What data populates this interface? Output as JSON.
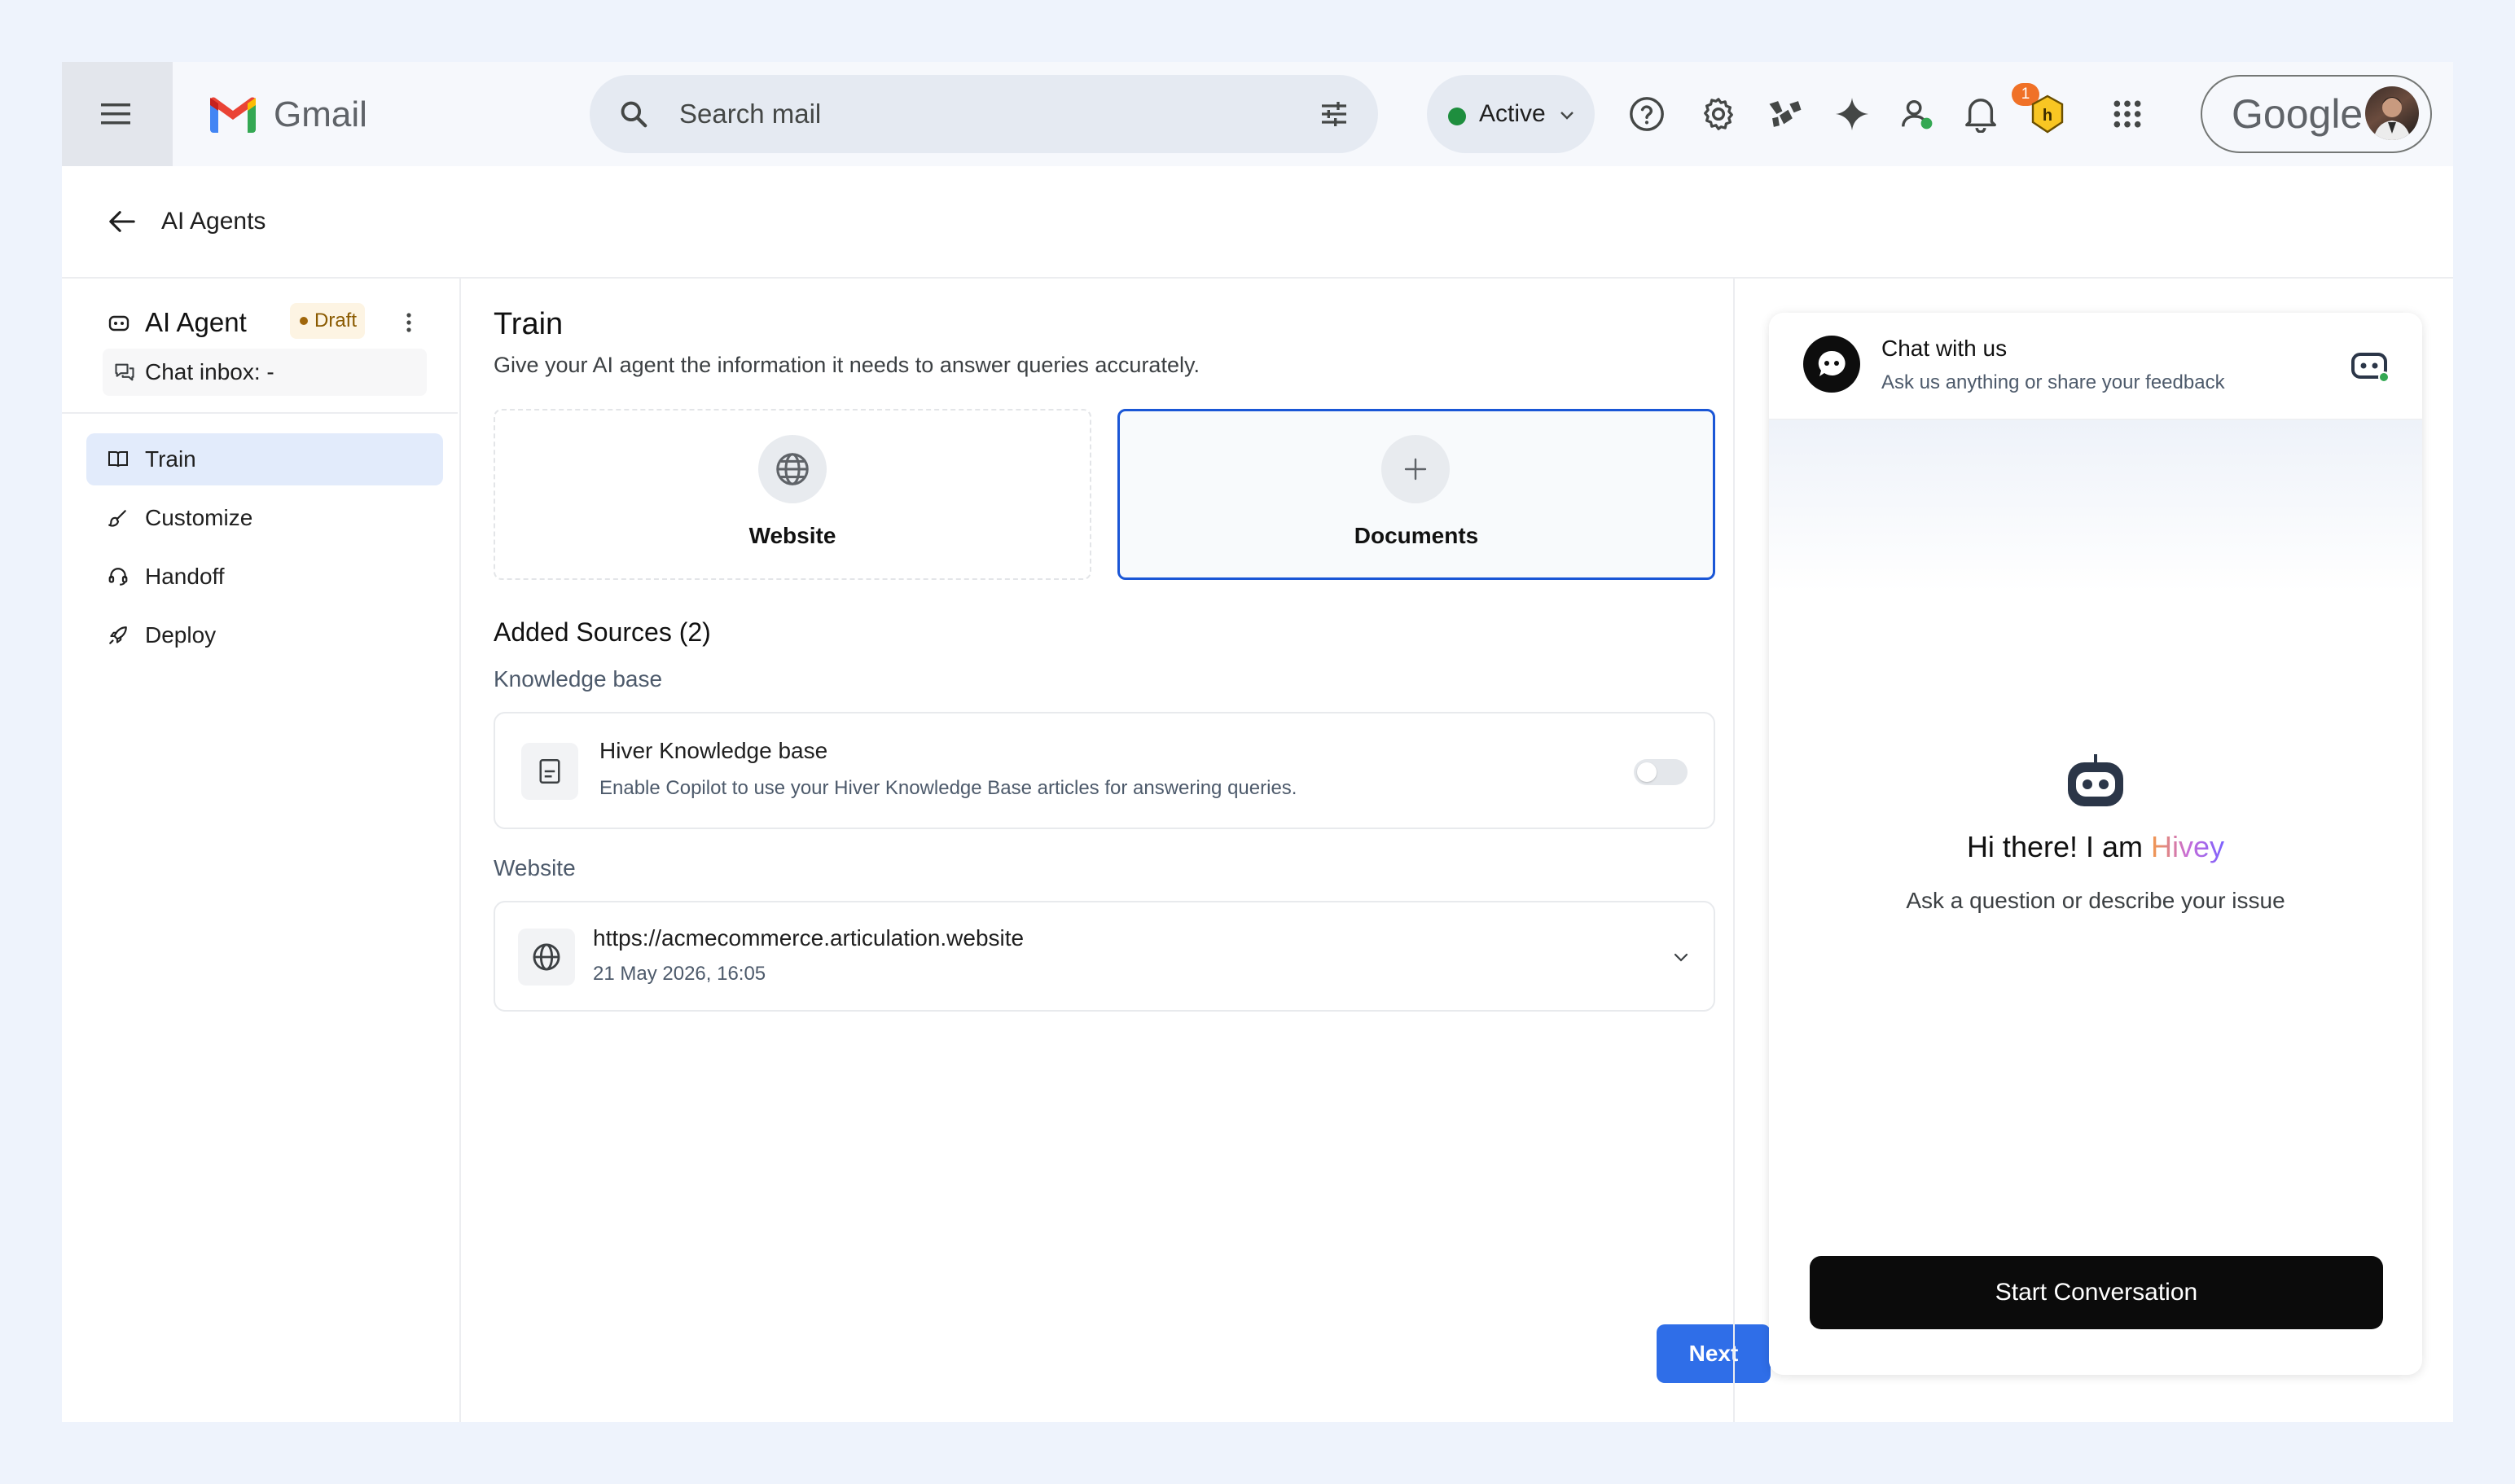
{
  "gmail": {
    "app_name": "Gmail",
    "search_placeholder": "Search mail",
    "status": "Active",
    "notification_count": "1",
    "account_brand": "Google"
  },
  "header": {
    "title": "AI Agents"
  },
  "sidebar": {
    "agent_name": "AI Agent",
    "agent_status": "Draft",
    "chat_inbox_label": "Chat inbox: -",
    "items": [
      {
        "label": "Train",
        "icon": "book-icon",
        "active": true
      },
      {
        "label": "Customize",
        "icon": "brush-icon",
        "active": false
      },
      {
        "label": "Handoff",
        "icon": "headset-icon",
        "active": false
      },
      {
        "label": "Deploy",
        "icon": "rocket-icon",
        "active": false
      }
    ]
  },
  "main": {
    "title": "Train",
    "subtitle": "Give your AI agent the information it needs to answer queries accurately.",
    "source_cards": [
      {
        "label": "Website",
        "icon": "globe-icon"
      },
      {
        "label": "Documents",
        "icon": "plus-icon"
      }
    ],
    "added_sources_title": "Added Sources (2)",
    "knowledge_base_section": "Knowledge base",
    "knowledge_base": {
      "title": "Hiver Knowledge base",
      "description": "Enable Copilot to use your Hiver Knowledge Base articles for answering queries.",
      "enabled": false
    },
    "website_section": "Website",
    "website_source": {
      "url": "https://acmecommerce.articulation.website",
      "date": "21 May 2026, 16:05"
    },
    "next_label": "Next"
  },
  "chat_widget": {
    "title": "Chat with us",
    "subtitle": "Ask us anything or share your feedback",
    "greeting_prefix": "Hi there! I am ",
    "bot_name": "Hivey",
    "prompt": "Ask a question or describe your issue",
    "start_label": "Start Conversation"
  },
  "colors": {
    "accent": "#2f6ee8",
    "selected_border": "#1a56d6",
    "active_nav": "#e2ebfb",
    "status_green": "#1e8e3e",
    "badge_orange": "#f07127"
  }
}
